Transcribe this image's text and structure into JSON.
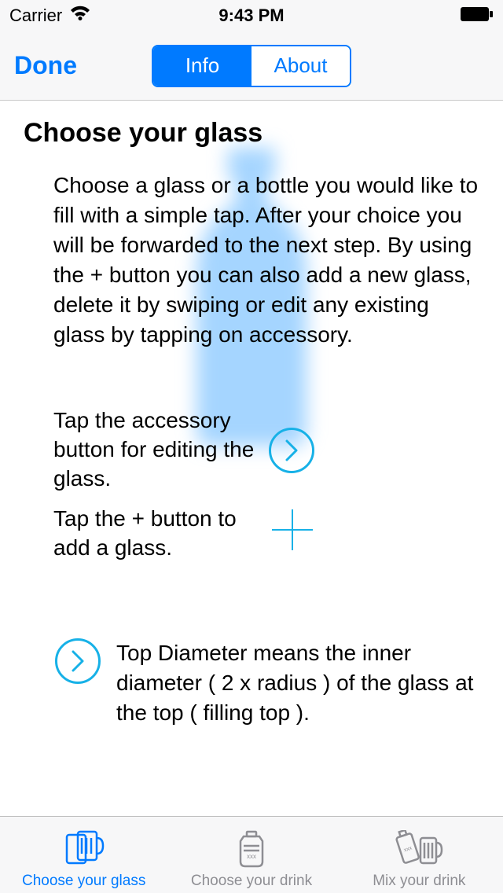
{
  "statusbar": {
    "carrier": "Carrier",
    "time": "9:43 PM"
  },
  "nav": {
    "done": "Done",
    "seg_info": "Info",
    "seg_about": "About"
  },
  "page": {
    "title": "Choose your glass",
    "intro": "Choose a glass or a bottle you would like to fill with a simple tap. After your choice you will be forwarded to the next step. By using the + button you can also add a new glass, delete it by swiping or edit any existing glass by tapping on accessory.",
    "tip_accessory": "Tap the accessory button for editing the glass.",
    "tip_add": "Tap the + button to add a glass.",
    "diameter": "Top Diameter means the inner diameter ( 2 x radius ) of the glass at the top ( filling top )."
  },
  "tabs": {
    "choose_glass": "Choose your glass",
    "choose_drink": "Choose your drink",
    "mix_drink": "Mix your drink"
  }
}
